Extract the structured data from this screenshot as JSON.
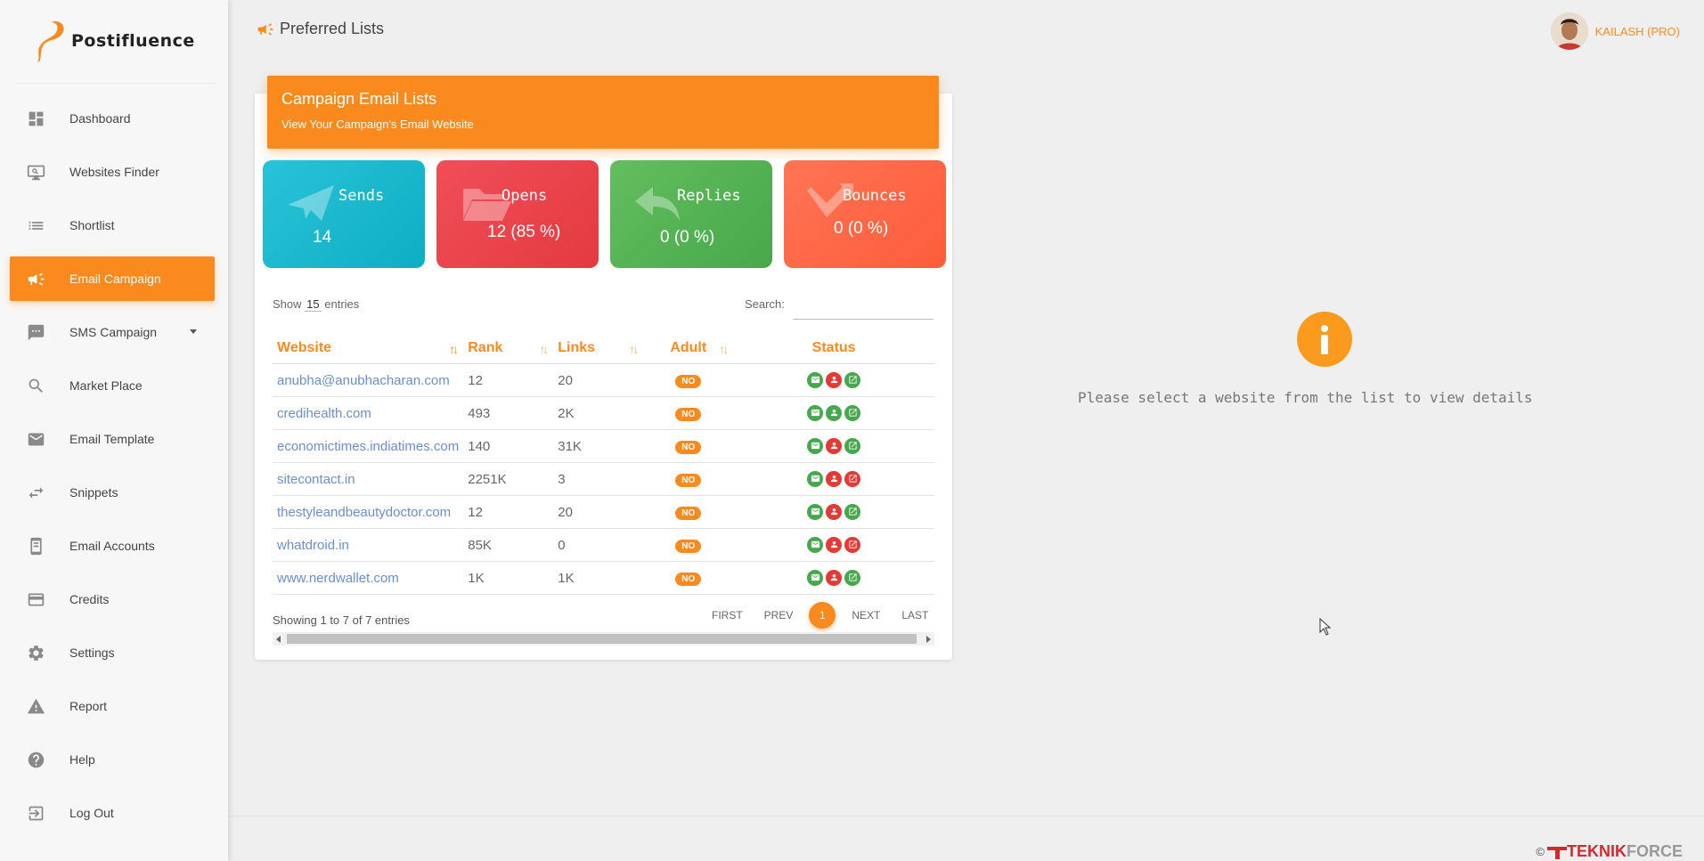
{
  "app": {
    "name": "Postifluence"
  },
  "sidebar": {
    "items": [
      {
        "label": "Dashboard",
        "icon": "dashboard-icon"
      },
      {
        "label": "Websites Finder",
        "icon": "monitor-search-icon"
      },
      {
        "label": "Shortlist",
        "icon": "list-icon"
      },
      {
        "label": "Email Campaign",
        "icon": "megaphone-icon",
        "active": true
      },
      {
        "label": "SMS Campaign",
        "icon": "chat-icon"
      },
      {
        "label": "Market Place",
        "icon": "search-icon"
      },
      {
        "label": "Email Template",
        "icon": "envelope-icon"
      },
      {
        "label": "Snippets",
        "icon": "swap-icon"
      },
      {
        "label": "Email Accounts",
        "icon": "phone-book-icon"
      },
      {
        "label": "Credits",
        "icon": "credit-card-icon"
      },
      {
        "label": "Settings",
        "icon": "gear-icon"
      },
      {
        "label": "Report",
        "icon": "warning-icon"
      },
      {
        "label": "Help",
        "icon": "help-icon"
      },
      {
        "label": "Log Out",
        "icon": "logout-icon"
      }
    ]
  },
  "header": {
    "title": "Preferred Lists",
    "user": "KAILASH (PRO)"
  },
  "card": {
    "title": "Campaign Email Lists",
    "subtitle": "View Your Campaign's Email Website",
    "stats": {
      "sends": {
        "label": "Sends",
        "value": "14"
      },
      "opens": {
        "label": "Opens",
        "value": "12 (85 %)"
      },
      "replies": {
        "label": "Replies",
        "value": "0 (0 %)"
      },
      "bounces": {
        "label": "Bounces",
        "value": "0 (0 %)"
      }
    },
    "show": {
      "prefix": "Show",
      "count": "15",
      "suffix": "entries"
    },
    "search_label": "Search:",
    "columns": [
      "Website",
      "Rank",
      "Links",
      "Adult",
      "Status"
    ],
    "rows": [
      {
        "site": "anubha@anubhacharan.com",
        "rank": "12",
        "links": "20",
        "adult": "NO",
        "status": [
          "g",
          "r",
          "g"
        ]
      },
      {
        "site": "credihealth.com",
        "rank": "493",
        "links": "2K",
        "adult": "NO",
        "status": [
          "g",
          "g",
          "g"
        ]
      },
      {
        "site": "economictimes.indiatimes.com",
        "rank": "140",
        "links": "31K",
        "adult": "NO",
        "status": [
          "g",
          "r",
          "g"
        ]
      },
      {
        "site": "sitecontact.in",
        "rank": "2251K",
        "links": "3",
        "adult": "NO",
        "status": [
          "g",
          "r",
          "r"
        ]
      },
      {
        "site": "thestyleandbeautydoctor.com",
        "rank": "12",
        "links": "20",
        "adult": "NO",
        "status": [
          "g",
          "r",
          "g"
        ]
      },
      {
        "site": "whatdroid.in",
        "rank": "85K",
        "links": "0",
        "adult": "NO",
        "status": [
          "g",
          "r",
          "r"
        ]
      },
      {
        "site": "www.nerdwallet.com",
        "rank": "1K",
        "links": "1K",
        "adult": "NO",
        "status": [
          "g",
          "r",
          "g"
        ]
      }
    ],
    "showing": "Showing 1 to 7 of 7 entries",
    "pager": {
      "first": "FIRST",
      "prev": "PREV",
      "current": "1",
      "next": "NEXT",
      "last": "LAST"
    }
  },
  "detail": {
    "message": "Please select a website from the list to view details"
  },
  "footer": {
    "copyright": "©",
    "brand_a": "TEKNIK",
    "brand_b": "FORCE"
  },
  "colors": {
    "accent": "#fb8a1e",
    "sends": "#1fb8cd",
    "opens": "#e8444b",
    "replies": "#55b354",
    "bounces": "#fe6846"
  }
}
